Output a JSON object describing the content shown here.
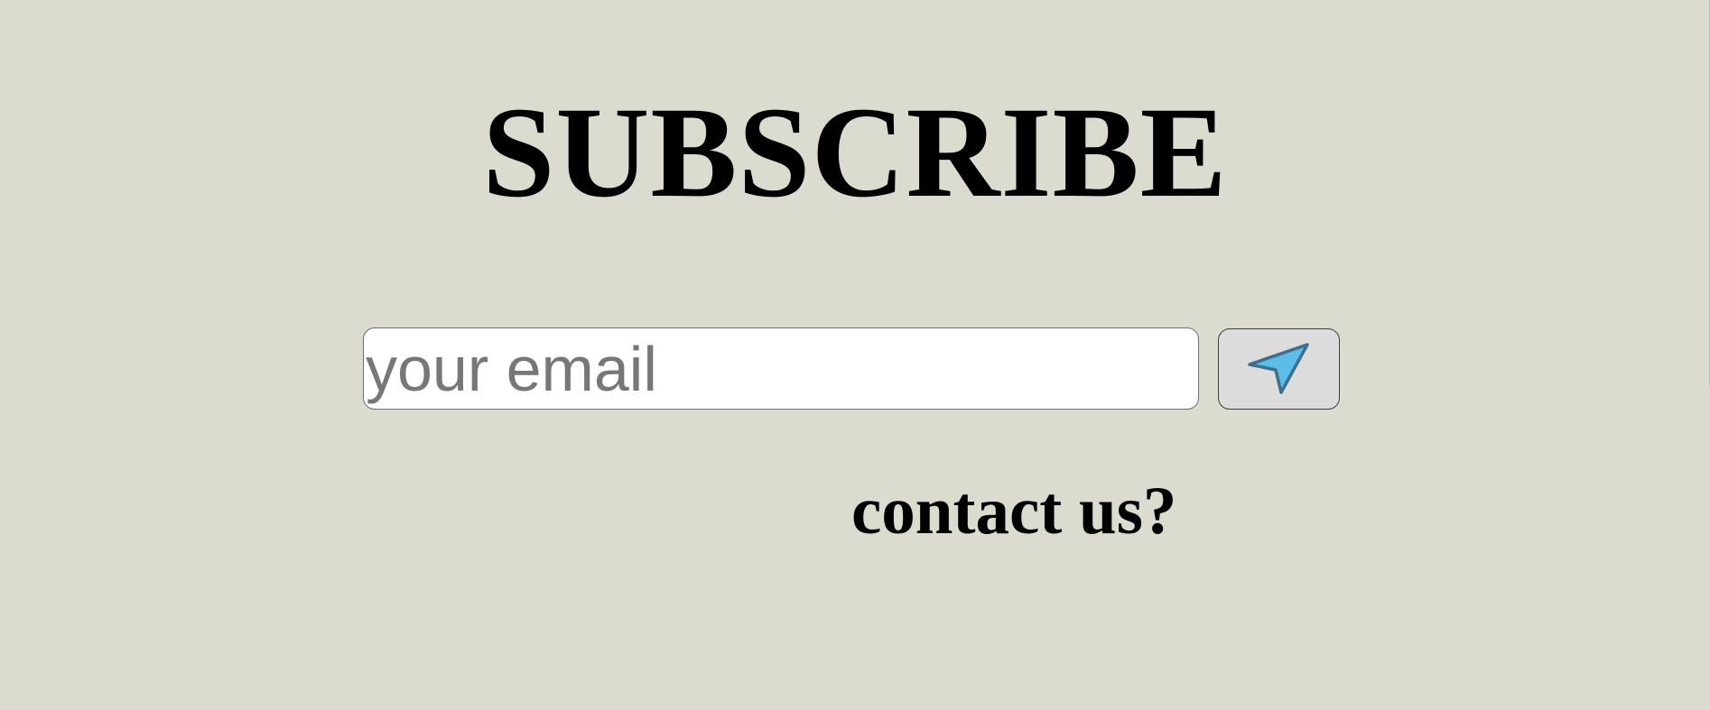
{
  "title": "SUBSCRIBE",
  "email": {
    "value": "",
    "placeholder": "your email"
  },
  "send_button": {
    "icon": "send-arrow-icon",
    "icon_color": "#5bbde8"
  },
  "contact_link": "contact us?",
  "colors": {
    "background": "#dbdccf",
    "input_background": "#ffffff",
    "button_background": "#dcdcdc"
  }
}
